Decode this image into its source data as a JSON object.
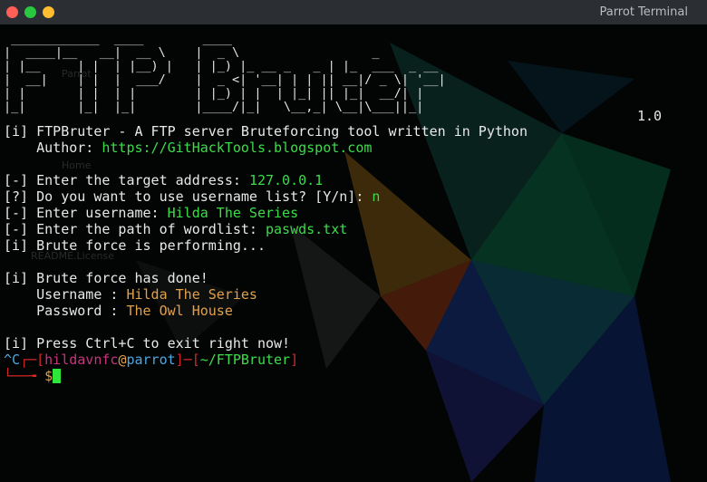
{
  "window": {
    "title": "Parrot Terminal",
    "colors": {
      "close": "#ff5f57",
      "minimize": "#28c840",
      "maximize": "#febc2e"
    }
  },
  "desktop": {
    "icons": [
      "Parrot",
      "Home",
      "README.License"
    ]
  },
  "terminal": {
    "banner": " ____________  ____        ____\n|  ____|__   __|  __ \\    |  _ \\                  _\n| |__     | |  | |__) |   | |_) |_ __ _   _ | |_  ___  _ __\n|  __|    | |  |  ___/    |  _ <| '__| | | || __|/ _ \\| '__|\n| |       | |  | |        | |_) | |  | |_| || |_|  __/| |\n|_|       |_|  |_|        |____/|_|   \\__,_| \\__|\\___||_|",
    "version": "1.0",
    "info_line": "[i] FTPBruter - A FTP server Bruteforcing tool written in Python",
    "author_label": "    Author: ",
    "author_url": "https://GitHackTools.blogspot.com",
    "prompts": [
      {
        "text": "[-] Enter the target address: ",
        "value": "127.0.0.1"
      },
      {
        "text": "[?] Do you want to use username list? [Y/n]: ",
        "value": "n"
      },
      {
        "text": "[-] Enter username: ",
        "value": "Hilda The Series"
      },
      {
        "text": "[-] Enter the path of wordlist: ",
        "value": "paswds.txt"
      }
    ],
    "performing": "[i] Brute force is performing...",
    "done": "[i] Brute force has done!",
    "username_label": "    Username : ",
    "username_value": "Hilda The Series",
    "password_label": "    Password : ",
    "password_value": "The Owl House",
    "exit_line": "[i] Press Ctrl+C to exit right now!",
    "shell": {
      "interrupt": "^C",
      "open_bracket": "┌─[",
      "user": "hildavnfc",
      "at": "@",
      "host": "parrot",
      "mid": "]─[",
      "path": "~/FTPBruter",
      "close_bracket": "]",
      "corner": "└──╼ ",
      "symbol": "$"
    }
  }
}
